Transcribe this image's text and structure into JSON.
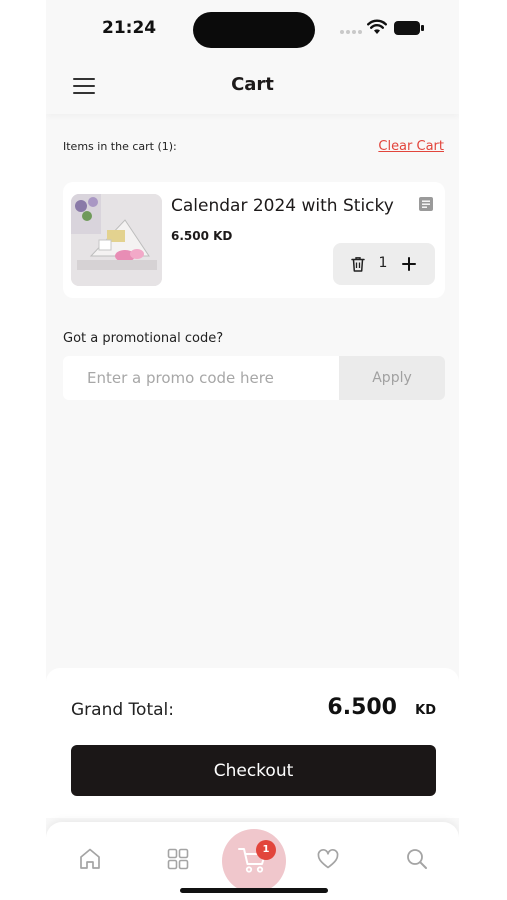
{
  "status_bar": {
    "time": "21:24"
  },
  "header": {
    "title": "Cart",
    "menu_icon": "hamburger-menu-icon"
  },
  "cart": {
    "items_count_label": "Items in the cart (1):",
    "clear_label": "Clear Cart",
    "items": [
      {
        "name": "Calendar 2024 with Sticky",
        "price": "6.500 KD",
        "quantity": "1"
      }
    ]
  },
  "promo": {
    "label": "Got a promotional code?",
    "placeholder": "Enter a promo code here",
    "apply_label": "Apply"
  },
  "summary": {
    "grand_total_label": "Grand Total:",
    "grand_total_value": "6.500",
    "currency": "KD",
    "checkout_label": "Checkout"
  },
  "bottom_nav": {
    "items": [
      {
        "icon": "home-icon"
      },
      {
        "icon": "categories-grid-icon"
      },
      {
        "icon": "cart-icon",
        "active": true,
        "badge": "1"
      },
      {
        "icon": "heart-icon"
      },
      {
        "icon": "search-icon"
      }
    ]
  },
  "colors": {
    "accent": "#e2453c",
    "checkout_bg": "#1b1717",
    "cart_active_bg": "#f0c7cc",
    "page_bg": "#f8f8f8"
  }
}
